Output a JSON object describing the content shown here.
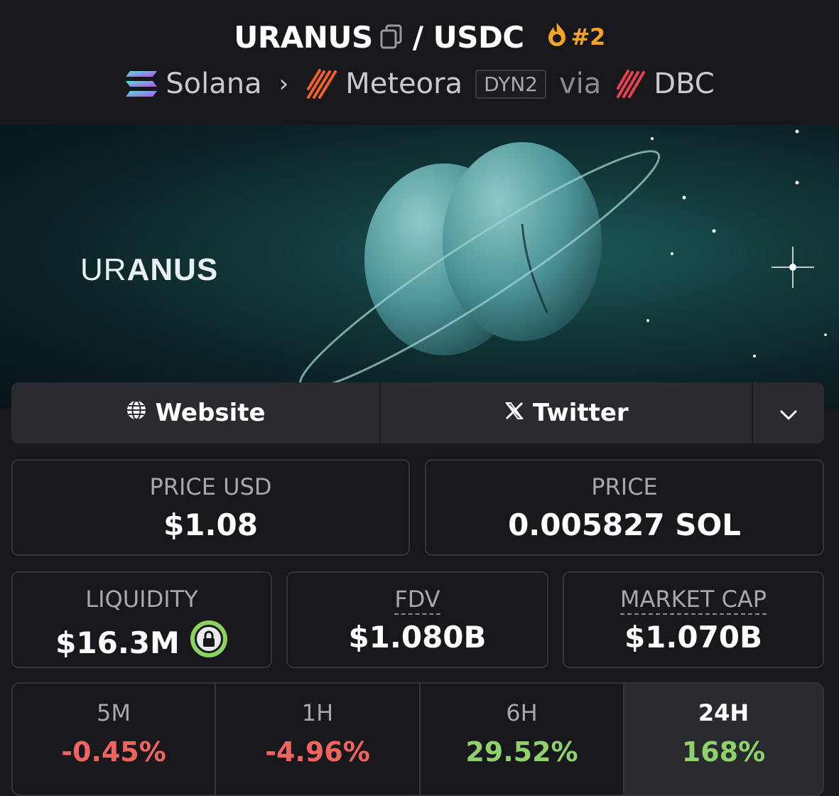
{
  "header": {
    "base_token": "URANUS",
    "separator": "/",
    "quote_token": "USDC",
    "rank": "#2",
    "chain": "Solana",
    "dex": "Meteora",
    "dex_badge": "DYN2",
    "via": "via",
    "launchpad": "DBC"
  },
  "banner": {
    "brand_light": "UR",
    "brand_bold": "ANUS"
  },
  "links": {
    "website": "Website",
    "twitter": "Twitter"
  },
  "stats": {
    "price_usd_label": "PRICE USD",
    "price_usd": "$1.08",
    "price_label": "PRICE",
    "price": "0.005827 SOL",
    "liquidity_label": "LIQUIDITY",
    "liquidity": "$16.3M",
    "fdv_label": "FDV",
    "fdv": "$1.080B",
    "mcap_label": "MARKET CAP",
    "mcap": "$1.070B"
  },
  "changes": [
    {
      "label": "5M",
      "value": "-0.45%"
    },
    {
      "label": "1H",
      "value": "-4.96%"
    },
    {
      "label": "6H",
      "value": "29.52%"
    },
    {
      "label": "24H",
      "value": "168%"
    }
  ],
  "colors": {
    "negative": "#f0645f",
    "positive": "#8fd16a",
    "rank": "#f5a524",
    "lock": "#8bd35f"
  }
}
